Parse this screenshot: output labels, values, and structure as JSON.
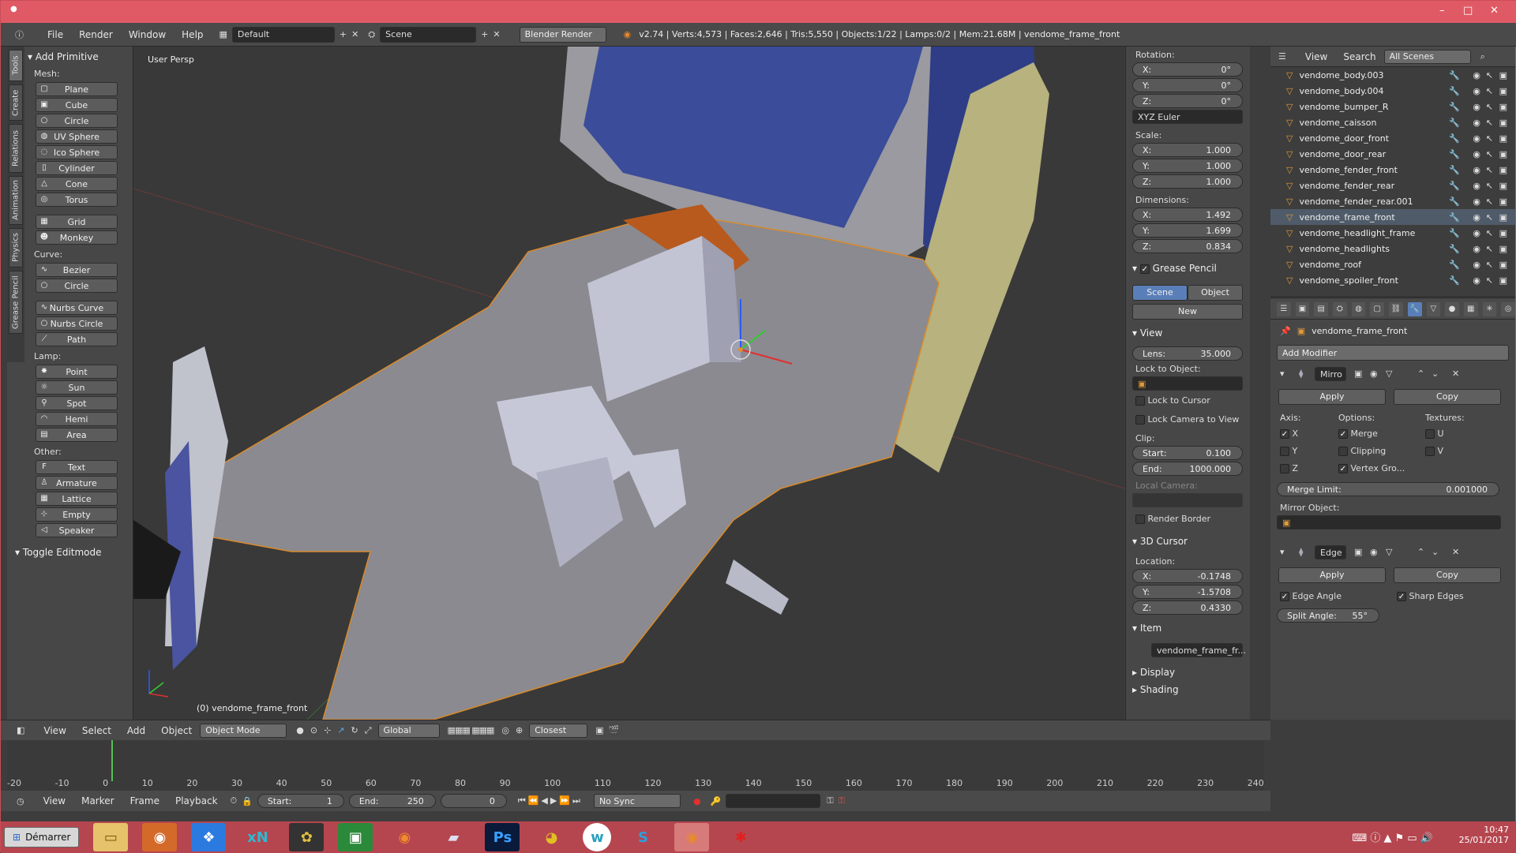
{
  "titlebar": {
    "minimize": "–",
    "maximize": "□",
    "close": "✕"
  },
  "menu": {
    "items": [
      "File",
      "Render",
      "Window",
      "Help"
    ],
    "layout": "Default",
    "scene": "Scene",
    "engine": "Blender Render",
    "stats": "v2.74 | Verts:4,573 | Faces:2,646 | Tris:5,550 | Objects:1/22 | Lamps:0/2 | Mem:21.68M | vendome_frame_front"
  },
  "toolshelf": {
    "tabs": [
      "Tools",
      "Create",
      "Relations",
      "Animation",
      "Physics",
      "Grease Pencil"
    ],
    "panel_title": "Add Primitive",
    "mesh_label": "Mesh:",
    "mesh": [
      "Plane",
      "Cube",
      "Circle",
      "UV Sphere",
      "Ico Sphere",
      "Cylinder",
      "Cone",
      "Torus"
    ],
    "mesh2": [
      "Grid",
      "Monkey"
    ],
    "curve_label": "Curve:",
    "curve": [
      "Bezier",
      "Circle"
    ],
    "curve2": [
      "Nurbs Curve",
      "Nurbs Circle",
      "Path"
    ],
    "lamp_label": "Lamp:",
    "lamp": [
      "Point",
      "Sun",
      "Spot",
      "Hemi",
      "Area"
    ],
    "other_label": "Other:",
    "other": [
      "Text",
      "Armature",
      "Lattice",
      "Empty",
      "Speaker"
    ],
    "toggle": "Toggle Editmode"
  },
  "viewport": {
    "label": "User Persp",
    "objname": "(0) vendome_frame_front"
  },
  "npanel": {
    "rotation_label": "Rotation:",
    "rotation": [
      {
        "k": "X:",
        "v": "0°"
      },
      {
        "k": "Y:",
        "v": "0°"
      },
      {
        "k": "Z:",
        "v": "0°"
      }
    ],
    "euler": "XYZ Euler",
    "scale_label": "Scale:",
    "scale": [
      {
        "k": "X:",
        "v": "1.000"
      },
      {
        "k": "Y:",
        "v": "1.000"
      },
      {
        "k": "Z:",
        "v": "1.000"
      }
    ],
    "dim_label": "Dimensions:",
    "dim": [
      {
        "k": "X:",
        "v": "1.492"
      },
      {
        "k": "Y:",
        "v": "1.699"
      },
      {
        "k": "Z:",
        "v": "0.834"
      }
    ],
    "grease": "Grease Pencil",
    "scene_btn": "Scene",
    "object_btn": "Object",
    "new_btn": "New",
    "view": "View",
    "lens": {
      "k": "Lens:",
      "v": "35.000"
    },
    "lock_obj": "Lock to Object:",
    "lock_cursor": "Lock to Cursor",
    "lock_camera": "Lock Camera to View",
    "clip": "Clip:",
    "clip_start": {
      "k": "Start:",
      "v": "0.100"
    },
    "clip_end": {
      "k": "End:",
      "v": "1000.000"
    },
    "local_camera": "Local Camera:",
    "render_border": "Render Border",
    "cursor3d": "3D Cursor",
    "location": "Location:",
    "loc": [
      {
        "k": "X:",
        "v": "-0.1748"
      },
      {
        "k": "Y:",
        "v": "-1.5708"
      },
      {
        "k": "Z:",
        "v": "0.4330"
      }
    ],
    "item": "Item",
    "item_name": "vendome_frame_fr...",
    "display": "Display",
    "shading": "Shading"
  },
  "outliner": {
    "view": "View",
    "search": "Search",
    "scenes": "All Scenes",
    "rows": [
      "vendome_body.003",
      "vendome_body.004",
      "vendome_bumper_R",
      "vendome_caisson",
      "vendome_door_front",
      "vendome_door_rear",
      "vendome_fender_front",
      "vendome_fender_rear",
      "vendome_fender_rear.001",
      "vendome_frame_front",
      "vendome_headlight_frame",
      "vendome_headlights",
      "vendome_roof",
      "vendome_spoiler_front"
    ]
  },
  "props": {
    "object": "vendome_frame_front",
    "add_modifier": "Add Modifier",
    "mod1": {
      "name": "Mirro",
      "apply": "Apply",
      "copy": "Copy",
      "axis": "Axis:",
      "options": "Options:",
      "textures": "Textures:",
      "x": "X",
      "y": "Y",
      "z": "Z",
      "merge": "Merge",
      "clipping": "Clipping",
      "vertex": "Vertex Gro...",
      "u": "U",
      "v": "V",
      "merge_limit": {
        "k": "Merge Limit:",
        "v": "0.001000"
      },
      "mirror_obj": "Mirror Object:"
    },
    "mod2": {
      "name": "Edge",
      "apply": "Apply",
      "copy": "Copy",
      "edge_angle": "Edge Angle",
      "sharp_edges": "Sharp Edges",
      "split_angle": {
        "k": "Split Angle:",
        "v": "55°"
      }
    }
  },
  "vpheader": {
    "items": [
      "View",
      "Select",
      "Add",
      "Object"
    ],
    "mode": "Object Mode",
    "orientation": "Global",
    "snap": "Closest"
  },
  "timeline": {
    "ticks": [
      "-20",
      "-10",
      "0",
      "10",
      "20",
      "30",
      "40",
      "50",
      "60",
      "70",
      "80",
      "90",
      "100",
      "110",
      "120",
      "130",
      "140",
      "150",
      "160",
      "170",
      "180",
      "190",
      "200",
      "210",
      "220",
      "230",
      "240"
    ],
    "items": [
      "View",
      "Marker",
      "Frame",
      "Playback"
    ],
    "start": {
      "k": "Start:",
      "v": "1"
    },
    "end": {
      "k": "End:",
      "v": "250"
    },
    "current": "0",
    "sync": "No Sync"
  },
  "taskbar": {
    "start": "Démarrer",
    "time": "10:47",
    "date": "25/01/2017"
  }
}
